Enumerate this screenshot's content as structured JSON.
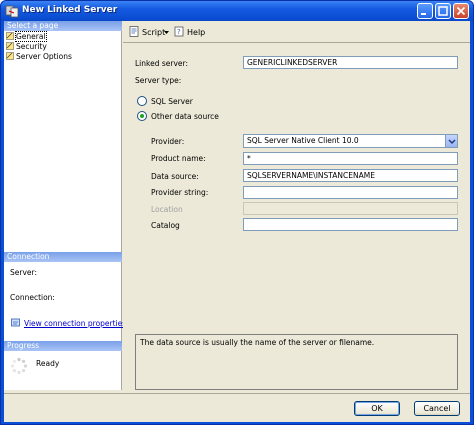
{
  "window": {
    "title": "New Linked Server"
  },
  "select_page": {
    "header": "Select a page",
    "items": [
      {
        "label": "General",
        "selected": true
      },
      {
        "label": "Security",
        "selected": false
      },
      {
        "label": "Server Options",
        "selected": false
      }
    ]
  },
  "connection": {
    "header": "Connection",
    "server_label": "Server:",
    "connection_label": "Connection:",
    "view_link": "View connection properties"
  },
  "progress": {
    "header": "Progress",
    "status": "Ready"
  },
  "toolbar": {
    "script_label": "Script",
    "help_label": "Help"
  },
  "form": {
    "linked_server_label": "Linked server:",
    "linked_server_value": "GENERICLINKEDSERVER",
    "server_type_label": "Server type:",
    "sql_server_label": "SQL Server",
    "other_source_label": "Other data source",
    "server_type_selected": "Other data source",
    "provider_label": "Provider:",
    "provider_value": "SQL Server Native Client 10.0",
    "product_name_label": "Product name:",
    "product_name_value": "*",
    "data_source_label": "Data source:",
    "data_source_value": "SQLSERVERNAME\\INSTANCENAME",
    "provider_string_label": "Provider string:",
    "provider_string_value": "",
    "location_label": "Location",
    "location_value": "",
    "catalog_label": "Catalog",
    "catalog_value": ""
  },
  "description": "The data source is usually the name of the server or filename.",
  "buttons": {
    "ok": "OK",
    "cancel": "Cancel"
  },
  "colors": {
    "title_bar": "#0b4fd4",
    "dialog_bg": "#ece9d8",
    "section_header": "#7aa0e8",
    "link": "#0000cc"
  }
}
